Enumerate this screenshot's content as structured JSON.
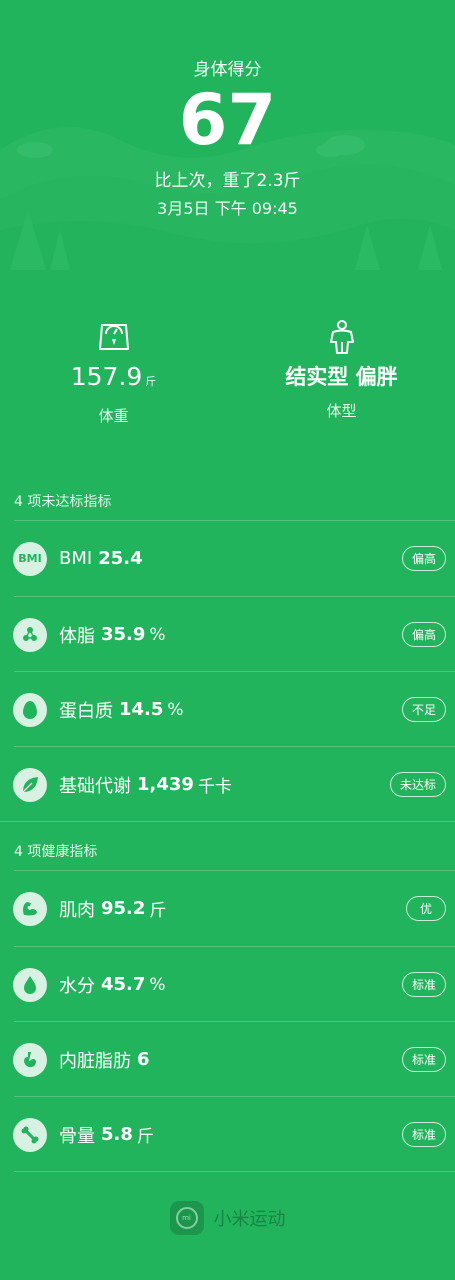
{
  "header": {
    "title": "身体得分",
    "score": "67",
    "change": "比上次，重了2.3斤",
    "time": "3月5日 下午 09:45"
  },
  "summary": {
    "weight": {
      "value": "157.9",
      "unit": "斤",
      "label": "体重"
    },
    "body_type": {
      "value": "结实型 偏胖",
      "label": "体型"
    }
  },
  "sections": [
    {
      "title": "4 项未达标指标",
      "items": [
        {
          "icon": "bmi-icon",
          "name": "BMI",
          "value": "25.4",
          "unit": "",
          "badge": "偏高"
        },
        {
          "icon": "body-fat-icon",
          "name": "体脂",
          "value": "35.9",
          "unit": "%",
          "badge": "偏高"
        },
        {
          "icon": "protein-egg-icon",
          "name": "蛋白质",
          "value": "14.5",
          "unit": "%",
          "badge": "不足"
        },
        {
          "icon": "metabolism-leaf-icon",
          "name": "基础代谢",
          "value": "1,439",
          "unit": "千卡",
          "badge": "未达标"
        }
      ]
    },
    {
      "title": "4 项健康指标",
      "items": [
        {
          "icon": "muscle-icon",
          "name": "肌肉",
          "value": "95.2",
          "unit": "斤",
          "badge": "优"
        },
        {
          "icon": "water-drop-icon",
          "name": "水分",
          "value": "45.7",
          "unit": "%",
          "badge": "标准"
        },
        {
          "icon": "visceral-fat-icon",
          "name": "内脏脂肪",
          "value": "6",
          "unit": "",
          "badge": "标准"
        },
        {
          "icon": "bone-icon",
          "name": "骨量",
          "value": "5.8",
          "unit": "斤",
          "badge": "标准"
        }
      ]
    }
  ],
  "bmi_icon_text": "BMI",
  "footer": {
    "app_name": "小米运动",
    "logo_text": "mi"
  },
  "colors": {
    "background": "#22b45d",
    "icon_circle": "#ffffff"
  }
}
